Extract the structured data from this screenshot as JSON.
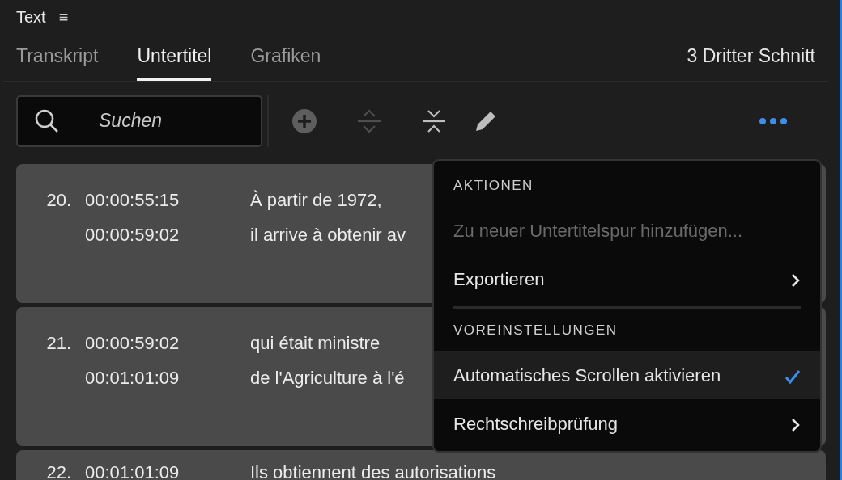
{
  "panel": {
    "title": "Text",
    "menu_icon": "≡"
  },
  "tabs": [
    {
      "label": "Transkript",
      "selected": false
    },
    {
      "label": "Untertitel",
      "selected": true
    },
    {
      "label": "Grafiken",
      "selected": false
    }
  ],
  "sequence": "3 Dritter Schnitt",
  "search": {
    "placeholder": "Suchen"
  },
  "toolbar": [
    {
      "disabled": false
    },
    {
      "disabled": true
    },
    {
      "disabled": false
    },
    {
      "disabled": false
    }
  ],
  "captions": [
    {
      "number": "20.",
      "start": "00:00:55:15",
      "end": "00:00:59:02",
      "lines": [
        "À partir de 1972,",
        "il arrive à obtenir av"
      ]
    },
    {
      "number": "21.",
      "start": "00:00:59:02",
      "end": "00:01:01:09",
      "lines": [
        "qui était ministre",
        "de l'Agriculture à l'é"
      ]
    },
    {
      "number": "22.",
      "start": "00:01:01:09",
      "lines": [
        "Ils obtiennent des autorisations"
      ]
    }
  ],
  "menu": {
    "sections": [
      {
        "header": "AKTIONEN",
        "items": [
          {
            "label": "Zu neuer Untertitelspur hinzufügen...",
            "disabled": true,
            "submenu": false,
            "checked": false,
            "selected": false
          },
          {
            "label": "Exportieren",
            "disabled": false,
            "submenu": true,
            "checked": false,
            "selected": false
          }
        ]
      },
      {
        "header": "VOREINSTELLUNGEN",
        "items": [
          {
            "label": "Automatisches Scrollen aktivieren",
            "disabled": false,
            "submenu": false,
            "checked": true,
            "selected": true
          },
          {
            "label": "Rechtschreibprüfung",
            "disabled": false,
            "submenu": true,
            "checked": false,
            "selected": false
          }
        ]
      }
    ]
  }
}
